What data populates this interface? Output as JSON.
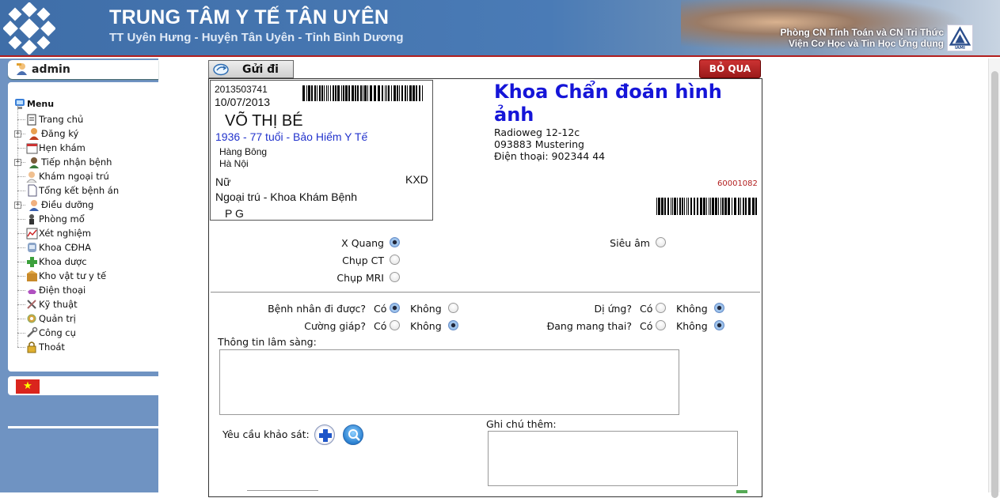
{
  "header": {
    "title": "TRUNG TÂM Y TẾ TÂN UYÊN",
    "subtitle": "TT Uyên Hưng - Huyện Tân Uyên - Tỉnh Bình Dương",
    "org_line1": "Phòng CN Tính Toán và CN Tri Thức",
    "org_line2": "Viện Cơ Học và Tin Học Ứng dụng",
    "org_logo_text": "IAMI"
  },
  "user": {
    "name": "admin"
  },
  "menu": {
    "title": "Menu",
    "items": [
      {
        "label": "Trang chủ",
        "icon": "home-icon",
        "expandable": false
      },
      {
        "label": "Đăng ký",
        "icon": "register-icon",
        "expandable": true
      },
      {
        "label": "Hẹn khám",
        "icon": "calendar-icon",
        "expandable": false
      },
      {
        "label": "Tiếp nhận bệnh",
        "icon": "reception-icon",
        "expandable": true
      },
      {
        "label": "Khám ngoại trú",
        "icon": "doctor-icon",
        "expandable": false
      },
      {
        "label": "Tổng kết bệnh án",
        "icon": "document-icon",
        "expandable": false
      },
      {
        "label": "Điều dưỡng",
        "icon": "nurse-icon",
        "expandable": true
      },
      {
        "label": "Phòng mổ",
        "icon": "surgery-icon",
        "expandable": false
      },
      {
        "label": "Xét nghiệm",
        "icon": "lab-chart-icon",
        "expandable": false
      },
      {
        "label": "Khoa CĐHA",
        "icon": "imaging-icon",
        "expandable": false
      },
      {
        "label": "Khoa dược",
        "icon": "pharmacy-icon",
        "expandable": false
      },
      {
        "label": "Kho vật tư y tế",
        "icon": "warehouse-icon",
        "expandable": false
      },
      {
        "label": "Điện thoại",
        "icon": "phone-icon",
        "expandable": false
      },
      {
        "label": "Kỹ thuật",
        "icon": "tools-icon",
        "expandable": false
      },
      {
        "label": "Quản trị",
        "icon": "admin-icon",
        "expandable": false
      },
      {
        "label": "Công cụ",
        "icon": "wrench-icon",
        "expandable": false
      },
      {
        "label": "Thoát",
        "icon": "lock-icon",
        "expandable": false
      }
    ]
  },
  "toolbar": {
    "send_label": "Gửi đi",
    "cancel_label": "BỎ QUA"
  },
  "patient": {
    "id": "2013503741",
    "date": "10/07/2013",
    "name": "VÕ THỊ  BÉ",
    "birth_line": "1936 - 77 tuổi -   Bảo Hiểm Y Tế",
    "address1": "Hàng Bông",
    "address2": "Hà Nội",
    "sex": "Nữ",
    "code": "KXD",
    "dept": "Ngoại trú - Khoa Khám Bệnh",
    "pg": "P    G"
  },
  "department": {
    "title": "Khoa Chẩn đoán hình ảnh",
    "address1": "Radioweg 12-12c",
    "address2": "093883 Mustering",
    "phone": "Điện thoại: 902344 44",
    "order_no": "60001082"
  },
  "modality": {
    "xquang": {
      "label": "X Quang",
      "checked": true
    },
    "ct": {
      "label": "Chụp CT",
      "checked": false
    },
    "mri": {
      "label": "Chụp MRI",
      "checked": false
    },
    "sieuam": {
      "label": "Siêu âm",
      "checked": false
    }
  },
  "questions": {
    "yes": "Có",
    "no": "Không",
    "walk": {
      "label": "Bệnh nhân đi được?",
      "answer": "yes"
    },
    "thyroid": {
      "label": "Cường giáp?",
      "answer": "no"
    },
    "allergy": {
      "label": "Dị ứng?",
      "answer": "no"
    },
    "pregnant": {
      "label": "Đang mang thai?",
      "answer": "no"
    }
  },
  "clinical": {
    "label": "Thông tin lâm sàng:",
    "value": ""
  },
  "survey": {
    "label": "Yêu cầu khảo sát:"
  },
  "notes": {
    "label": "Ghi chú thêm:",
    "value": ""
  },
  "colors": {
    "header_bg": "#4a7bb6",
    "accent_red": "#b21e1e",
    "dept_blue": "#1515d8",
    "sidebar_bg": "#6f93c2"
  }
}
